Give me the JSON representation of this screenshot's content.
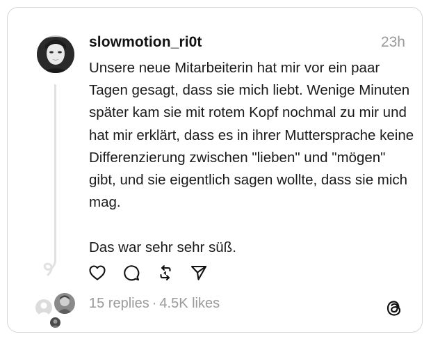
{
  "post": {
    "username": "slowmotion_ri0t",
    "timestamp": "23h",
    "text": "Unsere neue Mitarbeiterin hat mir vor ein paar Tagen gesagt, dass sie mich liebt. Wenige Minuten später kam sie mit rotem Kopf nochmal zu mir und hat mir erklärt, dass es in ihrer Muttersprache keine Differenzierung zwischen \"lieben\" und \"mögen\" gibt, und sie eigentlich sagen wollte, dass sie mich mag.\n\nDas war sehr sehr süß."
  },
  "actions": {
    "icons": [
      "heart-icon",
      "comment-icon",
      "repost-icon",
      "share-icon"
    ]
  },
  "stats": {
    "replies": "15 replies",
    "separator": "·",
    "likes": "4.5K likes"
  },
  "brand": {
    "logo": "threads-logo-icon",
    "text_color": "#111111",
    "muted_color": "#9a9a9a"
  }
}
